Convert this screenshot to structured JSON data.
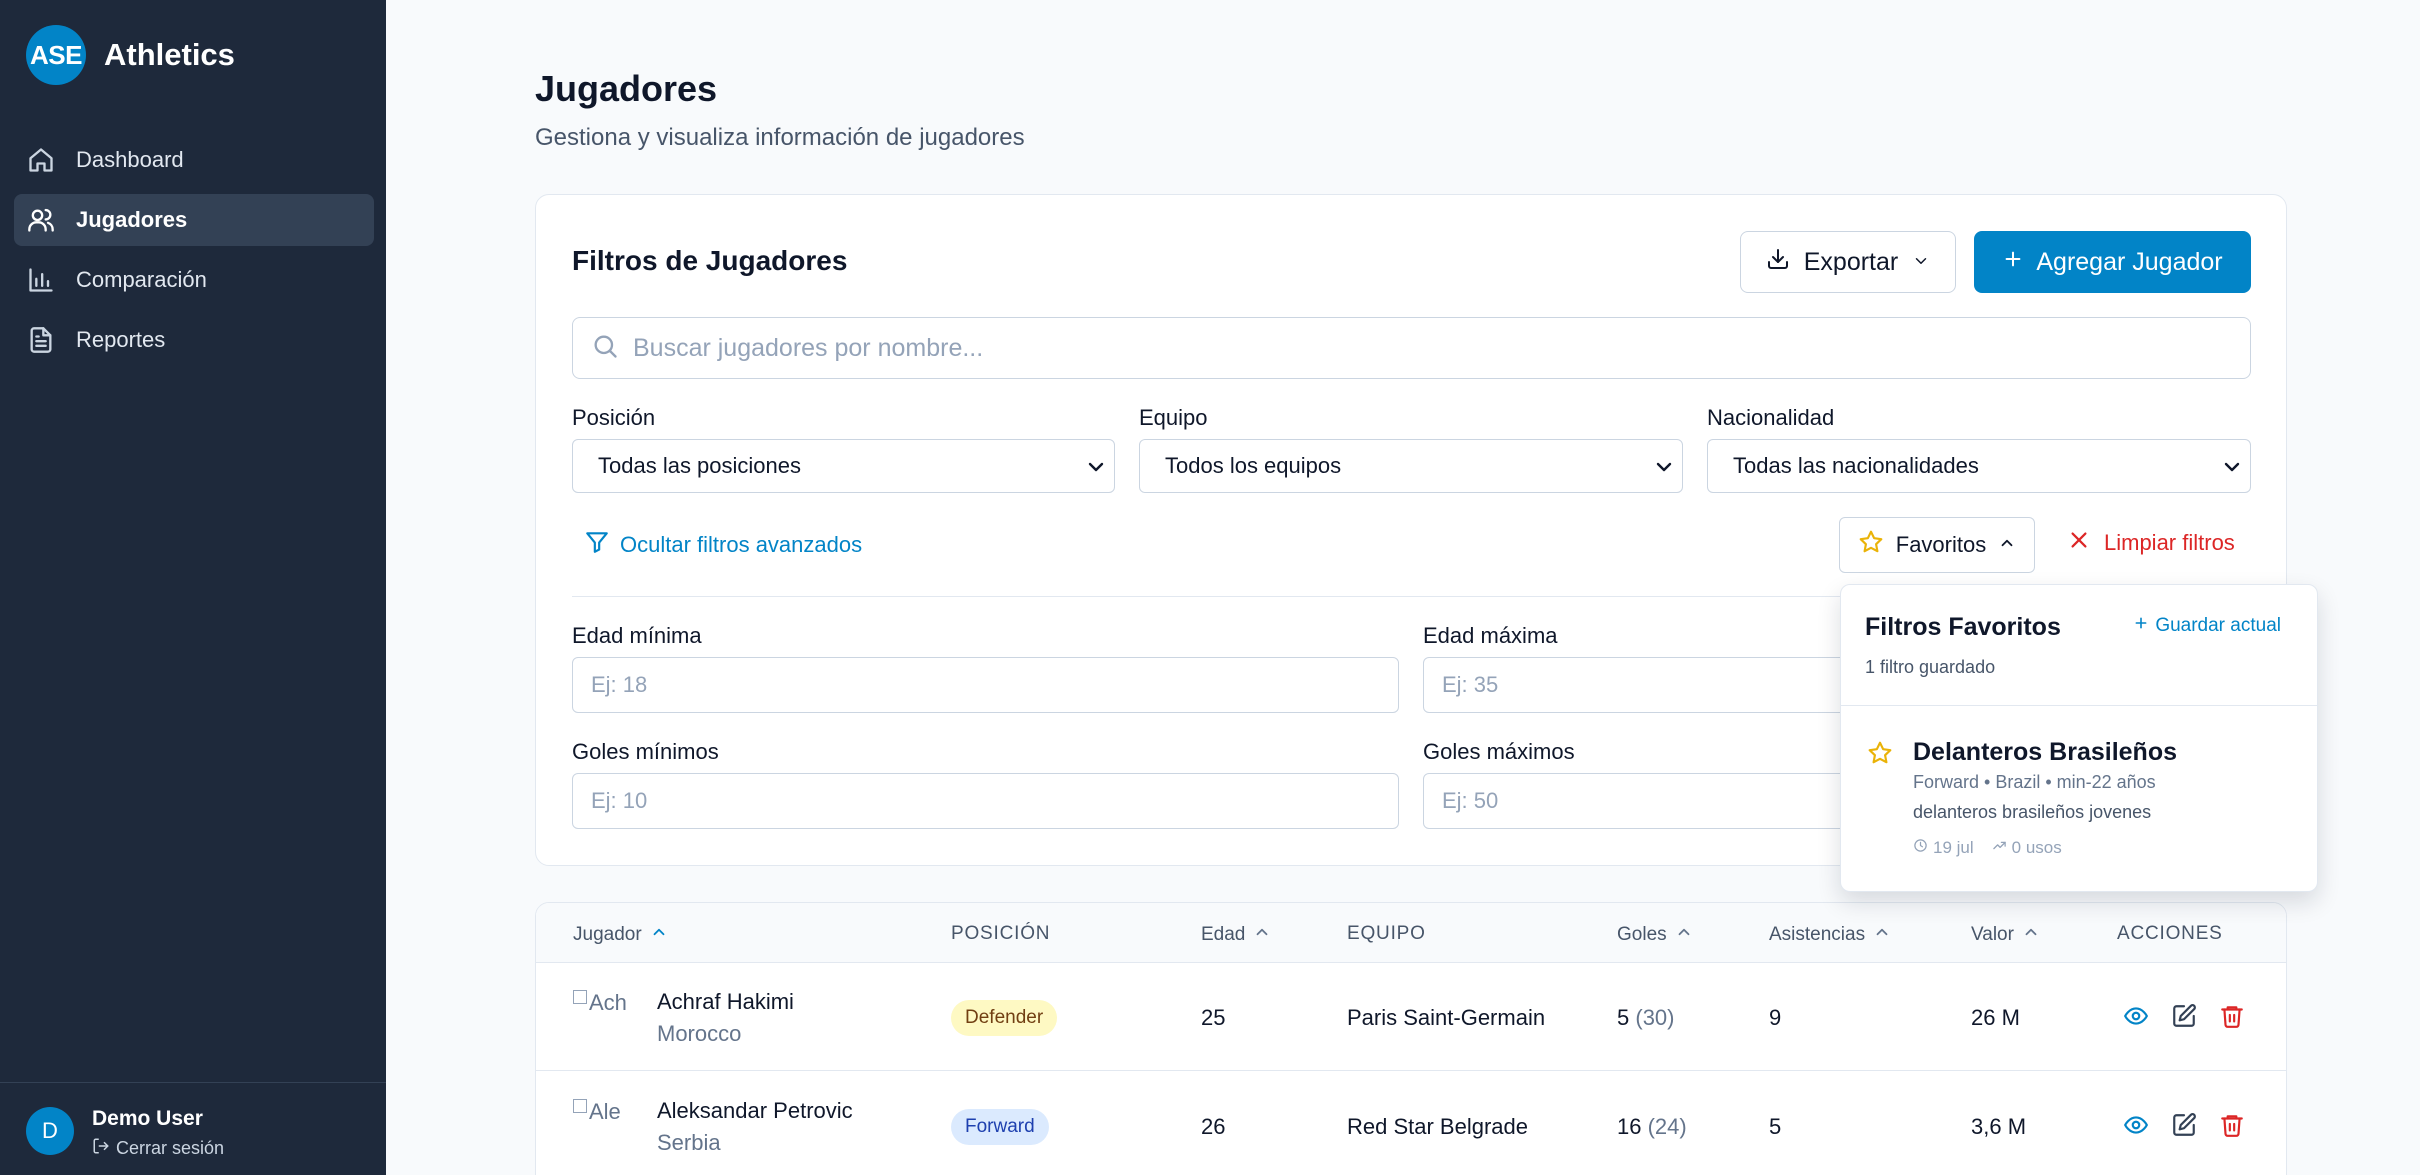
{
  "brand": {
    "logo": "ASE",
    "name": "Athletics"
  },
  "nav": [
    {
      "label": "Dashboard",
      "icon": "home-icon",
      "active": false
    },
    {
      "label": "Jugadores",
      "icon": "users-icon",
      "active": true
    },
    {
      "label": "Comparación",
      "icon": "bar-chart-icon",
      "active": false
    },
    {
      "label": "Reportes",
      "icon": "file-text-icon",
      "active": false
    }
  ],
  "user": {
    "initial": "D",
    "name": "Demo User",
    "logout": "Cerrar sesión"
  },
  "page": {
    "title": "Jugadores",
    "subtitle": "Gestiona y visualiza información de jugadores"
  },
  "filters": {
    "title": "Filtros de Jugadores",
    "export_label": "Exportar",
    "add_label": "Agregar Jugador",
    "search_placeholder": "Buscar jugadores por nombre...",
    "position": {
      "label": "Posición",
      "value": "Todas las posiciones"
    },
    "team": {
      "label": "Equipo",
      "value": "Todos los equipos"
    },
    "nationality": {
      "label": "Nacionalidad",
      "value": "Todas las nacionalidades"
    },
    "toggle_advanced": "Ocultar filtros avanzados",
    "favorites_label": "Favoritos",
    "clear_label": "Limpiar filtros",
    "age_min": {
      "label": "Edad mínima",
      "placeholder": "Ej: 18"
    },
    "age_max": {
      "label": "Edad máxima",
      "placeholder": "Ej: 35"
    },
    "goals_min": {
      "label": "Goles mínimos",
      "placeholder": "Ej: 10"
    },
    "goals_max": {
      "label": "Goles máximos",
      "placeholder": "Ej: 50"
    }
  },
  "favorites_popup": {
    "title": "Filtros Favoritos",
    "save_label": "Guardar actual",
    "count": "1 filtro guardado",
    "items": [
      {
        "name": "Delanteros Brasileños",
        "meta": "Forward • Brazil • min-22 años",
        "description": "delanteros brasileños jovenes",
        "date": "19 jul",
        "uses": "0 usos"
      }
    ]
  },
  "table": {
    "headers": {
      "player": "Jugador",
      "position": "POSICIÓN",
      "age": "Edad",
      "team": "EQUIPO",
      "goals": "Goles",
      "assists": "Asistencias",
      "value": "Valor",
      "actions": "ACCIONES"
    },
    "rows": [
      {
        "img_alt": "Ach",
        "name": "Achraf Hakimi",
        "nationality": "Morocco",
        "position": "Defender",
        "age": "25",
        "team": "Paris Saint-Germain",
        "goals": "5",
        "matches": "(30)",
        "assists": "9",
        "value": "26 M"
      },
      {
        "img_alt": "Ale",
        "name": "Aleksandar Petrovic",
        "nationality": "Serbia",
        "position": "Forward",
        "age": "26",
        "team": "Red Star Belgrade",
        "goals": "16",
        "matches": "(24)",
        "assists": "5",
        "value": "3,6 M"
      }
    ]
  },
  "colors": {
    "sidebar": "#1e293b",
    "accent": "#0284c7",
    "danger": "#dc2626",
    "star": "#eab308"
  }
}
